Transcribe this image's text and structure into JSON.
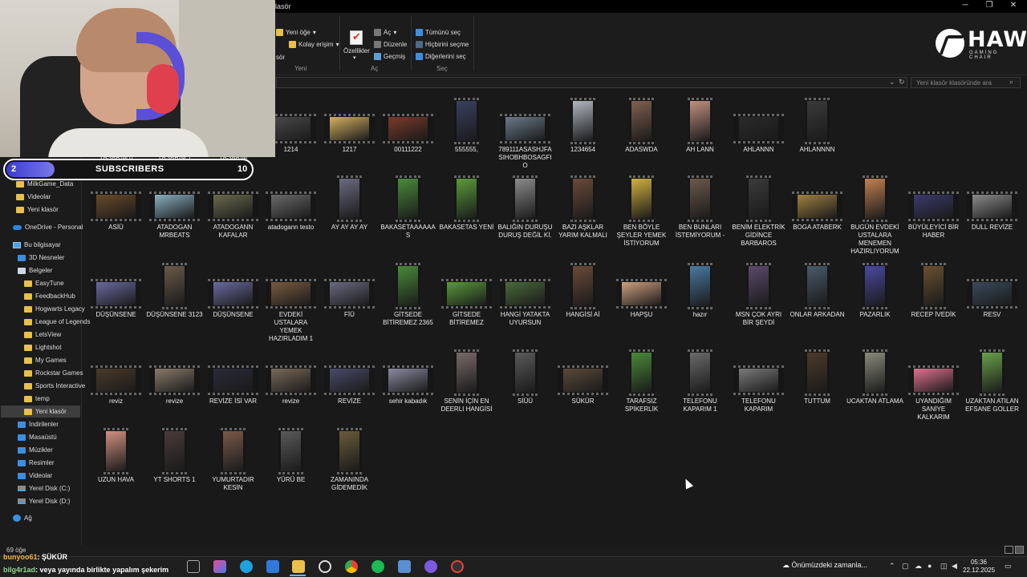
{
  "window": {
    "title": "lasör"
  },
  "ribbon": {
    "new_item": "Yeni öğe",
    "easy_access": "Kolay erişim",
    "folder_fragment": "sör",
    "properties": "Özellikler",
    "open": "Aç",
    "edit": "Düzenle",
    "history": "Geçmiş",
    "select_all": "Tümünü seç",
    "select_none": "Hiçbirini seçme",
    "invert_selection": "Diğerlerini seç",
    "group_new": "Yeni",
    "group_open": "Aç",
    "group_select": "Seç"
  },
  "brand": {
    "name": "HAWK",
    "tagline": "GAMING CHAIR"
  },
  "search": {
    "placeholder": "Yeni klasör klasöründe ara"
  },
  "nav": {
    "items": [
      "MilkGame_Data",
      "Videolar",
      "Yeni klasör",
      "OneDrive - Personal",
      "Bu bilgisayar",
      "3D Nesneler",
      "Belgeler",
      "EasyTune",
      "FeedbackHub",
      "Hogwarts Legacy",
      "League of Legends",
      "LetsView",
      "Lightshot",
      "My Games",
      "Rockstar Games",
      "Sports Interactive",
      "temp",
      "Yeni klasör",
      "İndirilenler",
      "Masaüstü",
      "Müzikler",
      "Resimler",
      "Videolar",
      "Yerel Disk (C:)",
      "Yerel Disk (D:)",
      "Ağ"
    ]
  },
  "files": [
    "5 YIL DAHA FAZLA YAŞARIM 0",
    "5 YIL DAHA FAZLA YAŞARIM 1",
    "5 YIL DAHA FAZLA YAŞARIM",
    "1214",
    "1217",
    "00111222",
    "555555,",
    "789111ASASHJFASIHOBHBOSAGFIO",
    "1234654",
    "ADASWDA",
    "AH LANN",
    "AHLANNN",
    "AHLANNNN",
    "ASİÜ",
    "ATADOGAN MRBEATS",
    "ATADOGANN KAFALAR",
    "atadogann testo",
    "AY AY AY AY",
    "BAKASETAAAAAAS",
    "BAKASETAS YENİ",
    "BALIĞIN DURUŞU DURUŞ DEĞİL Kİ.",
    "BAZI AŞKLAR YARIM KALMALI",
    "BEN BÖYLE ŞEYLER YEMEK İSTİYORUM",
    "BEN BUNLARI İSTEMİYORUM -",
    "BENİM ELEKTRİK GİDİNCE BARBAROS",
    "BOGA ATABERK",
    "BUGÜN EVDEKİ USTALARA MENEMEN HAZIRLIYORUM",
    "BÜYÜLEYİCİ BİR HABER",
    "DULL REVİZE",
    "DÜŞÜNSENE",
    "DÜŞÜNSENE 3123",
    "DÜŞÜNSENE",
    "EVDEKİ USTALARA YEMEK HAZIRLADIM 1",
    "FİÜ",
    "GİTSEDE BİTİREMEZ 2365",
    "GİTSEDE BİTİREMEZ",
    "HANGİ YATAKTA UYURSUN",
    "HANGİSİ Aİ",
    "HAPŞU",
    "hazır",
    "MSN ÇOK AYRI BİR ŞEYDİ",
    "ONLAR ARKADAN",
    "PAZARLIK",
    "RECEP İVEDİK",
    "RESV",
    "reviz",
    "revize",
    "REVİZE İSİ VAR",
    "revize",
    "REVİZE",
    "sehir kabadık",
    "SENİN İÇİN EN DEERLI HANGİSİ",
    "SİÜÜ",
    "SÜKÜR",
    "TARAFSIZ SPİKERLİK",
    "TELEFONU KAPARIM 1",
    "TELEFONU KAPARIM",
    "TUTTUM",
    "UCAKTAN ATLAMA",
    "UYANDIĞIM SANİYE KALKARIM",
    "UZAKTAN ATILAN EFSANE GOLLER",
    "UZUN HAVA",
    "YT SHORTS 1",
    "YUMURTADIR KESİN",
    "YÜRÜ BE",
    "ZAMANINDA GİDEMEDİK"
  ],
  "status": {
    "item_count": "69 öğe"
  },
  "overlay": {
    "subscribers_label": "SUBSCRIBERS",
    "current": "2",
    "goal": "10",
    "chat": [
      {
        "user": "bunyoo61",
        "text": ": ŞÜKÜR"
      },
      {
        "user": "bilg4r1ad",
        "text": ": veya yayında birlikte yapalım şekerim"
      }
    ]
  },
  "taskbar": {
    "weather": "Önümüzdeki zamanla...",
    "time": "05:36",
    "date": "22.12.2025"
  }
}
